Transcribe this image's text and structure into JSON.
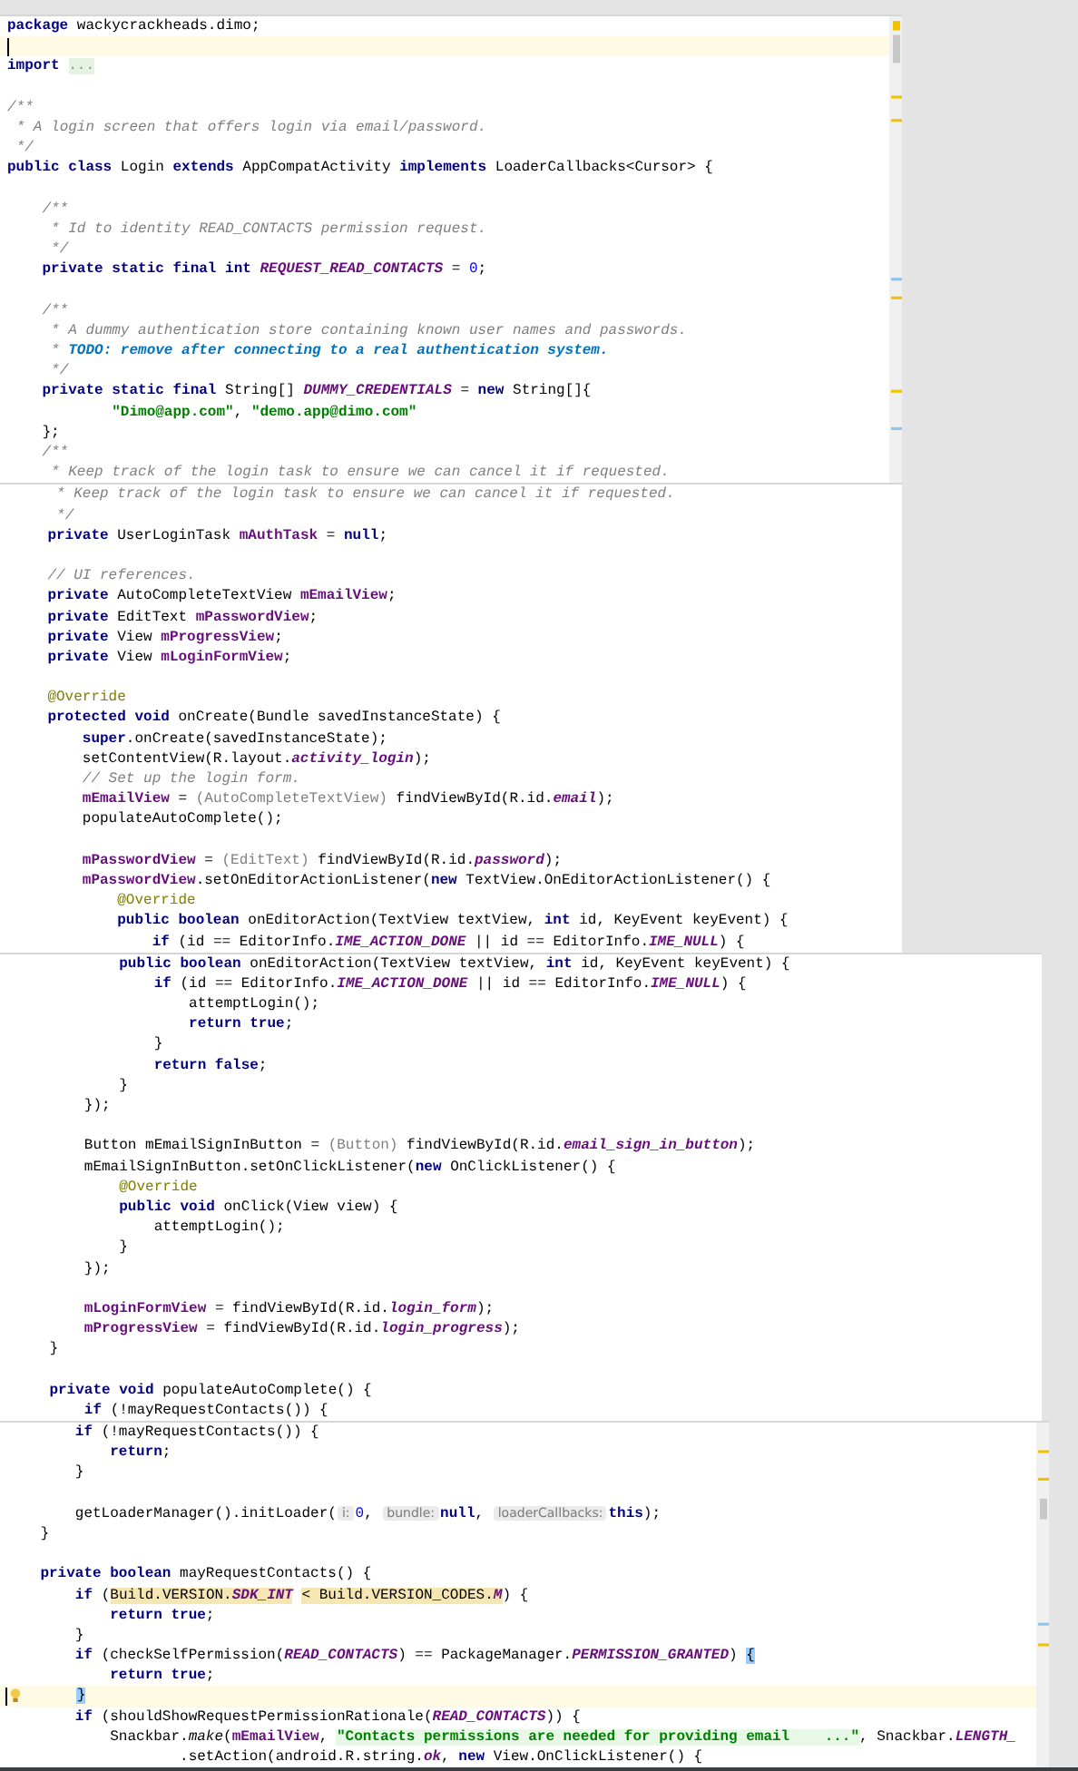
{
  "panels": [
    {
      "lines": [
        {
          "current": false,
          "bulb": false,
          "tokens": [
            {
              "kind": "kw",
              "text": "package"
            },
            {
              "kind": "plain",
              "text": " wackycrackheads.dimo;"
            }
          ]
        },
        {
          "current": true,
          "bulb": false
        },
        {
          "current": false,
          "bulb": false,
          "tokens": [
            {
              "kind": "kw",
              "text": "import "
            },
            {
              "kind": "fold",
              "text": "..."
            }
          ]
        },
        {
          "current": false,
          "bulb": false
        },
        {
          "current": false,
          "bulb": false,
          "tokens": [
            {
              "kind": "comment",
              "text": "/**"
            }
          ]
        },
        {
          "current": false,
          "bulb": false,
          "tokens": [
            {
              "kind": "comment",
              "text": " * A login screen that offers login via email/password."
            }
          ]
        },
        {
          "current": false,
          "bulb": false,
          "tokens": [
            {
              "kind": "comment",
              "text": " */"
            }
          ]
        },
        {
          "current": false,
          "bulb": false,
          "tokens": [
            {
              "kind": "kw",
              "text": "public class"
            },
            {
              "kind": "plain",
              "text": " Login "
            },
            {
              "kind": "kw",
              "text": "extends"
            },
            {
              "kind": "plain",
              "text": " AppCompatActivity "
            },
            {
              "kind": "kw",
              "text": "implements"
            },
            {
              "kind": "plain",
              "text": " LoaderCallbacks<Cursor> {"
            }
          ]
        },
        {
          "current": false,
          "bulb": false
        },
        {
          "current": false,
          "bulb": false,
          "tokens": [
            {
              "kind": "comment",
              "text": "    /**"
            }
          ]
        },
        {
          "current": false,
          "bulb": false,
          "tokens": [
            {
              "kind": "comment",
              "text": "     * Id to identity READ_CONTACTS permission request."
            }
          ]
        },
        {
          "current": false,
          "bulb": false,
          "tokens": [
            {
              "kind": "comment",
              "text": "     */"
            }
          ]
        },
        {
          "current": false,
          "bulb": false,
          "tokens": [
            {
              "kind": "kw",
              "text": "    private static final int "
            },
            {
              "kind": "const",
              "text": "REQUEST_READ_CONTACTS"
            },
            {
              "kind": "plain",
              "text": " = "
            },
            {
              "kind": "num",
              "text": "0"
            },
            {
              "kind": "plain",
              "text": ";"
            }
          ]
        },
        {
          "current": false,
          "bulb": false
        },
        {
          "current": false,
          "bulb": false,
          "tokens": [
            {
              "kind": "comment",
              "text": "    /**"
            }
          ]
        },
        {
          "current": false,
          "bulb": false,
          "tokens": [
            {
              "kind": "comment",
              "text": "     * A dummy authentication store containing known user names and passwords."
            }
          ]
        },
        {
          "current": false,
          "bulb": false,
          "tokens": [
            {
              "kind": "comment",
              "text": "     * "
            },
            {
              "kind": "todo",
              "text": "TODO: remove after connecting to a real authentication system."
            }
          ]
        },
        {
          "current": false,
          "bulb": false,
          "tokens": [
            {
              "kind": "comment",
              "text": "     */"
            }
          ]
        },
        {
          "current": false,
          "bulb": false,
          "tokens": [
            {
              "kind": "kw",
              "text": "    private static final"
            },
            {
              "kind": "plain",
              "text": " String[] "
            },
            {
              "kind": "const",
              "text": "DUMMY_CREDENTIALS"
            },
            {
              "kind": "plain",
              "text": " = "
            },
            {
              "kind": "kw",
              "text": "new"
            },
            {
              "kind": "plain",
              "text": " String[]{"
            }
          ]
        },
        {
          "current": false,
          "bulb": false,
          "tokens": [
            {
              "kind": "string",
              "text": "            \"Dimo@app.com\""
            },
            {
              "kind": "plain",
              "text": ", "
            },
            {
              "kind": "string",
              "text": "\"demo.app@dimo.com\""
            }
          ]
        },
        {
          "current": false,
          "bulb": false,
          "tokens": [
            {
              "kind": "plain",
              "text": "    };"
            }
          ]
        },
        {
          "current": false,
          "bulb": false,
          "tokens": [
            {
              "kind": "comment",
              "text": "    /**"
            }
          ]
        },
        {
          "current": false,
          "bulb": false,
          "tokens": [
            {
              "kind": "comment",
              "text": "     * Keep track of the login task to ensure we can cancel it if requested."
            }
          ]
        }
      ]
    },
    {
      "lines": [
        {
          "current": false,
          "bulb": false,
          "tokens": [
            {
              "kind": "comment",
              "text": "     * Keep track of the login task to ensure we can cancel it if requested."
            }
          ]
        },
        {
          "current": false,
          "bulb": false,
          "tokens": [
            {
              "kind": "comment",
              "text": "     */"
            }
          ]
        },
        {
          "current": false,
          "bulb": false,
          "tokens": [
            {
              "kind": "kw",
              "text": "    private"
            },
            {
              "kind": "plain",
              "text": " UserLoginTask "
            },
            {
              "kind": "field",
              "text": "mAuthTask"
            },
            {
              "kind": "plain",
              "text": " = "
            },
            {
              "kind": "kw",
              "text": "null"
            },
            {
              "kind": "plain",
              "text": ";"
            }
          ]
        },
        {
          "current": false,
          "bulb": false
        },
        {
          "current": false,
          "bulb": false,
          "tokens": [
            {
              "kind": "comment",
              "text": "    // UI references."
            }
          ]
        },
        {
          "current": false,
          "bulb": false,
          "tokens": [
            {
              "kind": "kw",
              "text": "    private"
            },
            {
              "kind": "plain",
              "text": " AutoCompleteTextView "
            },
            {
              "kind": "field",
              "text": "mEmailView"
            },
            {
              "kind": "plain",
              "text": ";"
            }
          ]
        },
        {
          "current": false,
          "bulb": false,
          "tokens": [
            {
              "kind": "kw",
              "text": "    private"
            },
            {
              "kind": "plain",
              "text": " EditText "
            },
            {
              "kind": "field",
              "text": "mPasswordView"
            },
            {
              "kind": "plain",
              "text": ";"
            }
          ]
        },
        {
          "current": false,
          "bulb": false,
          "tokens": [
            {
              "kind": "kw",
              "text": "    private"
            },
            {
              "kind": "plain",
              "text": " View "
            },
            {
              "kind": "field",
              "text": "mProgressView"
            },
            {
              "kind": "plain",
              "text": ";"
            }
          ]
        },
        {
          "current": false,
          "bulb": false,
          "tokens": [
            {
              "kind": "kw",
              "text": "    private"
            },
            {
              "kind": "plain",
              "text": " View "
            },
            {
              "kind": "field",
              "text": "mLoginFormView"
            },
            {
              "kind": "plain",
              "text": ";"
            }
          ]
        },
        {
          "current": false,
          "bulb": false
        },
        {
          "current": false,
          "bulb": false,
          "tokens": [
            {
              "kind": "anno",
              "text": "    @Override"
            }
          ]
        },
        {
          "current": false,
          "bulb": false,
          "tokens": [
            {
              "kind": "kw",
              "text": "    protected void"
            },
            {
              "kind": "plain",
              "text": " onCreate(Bundle savedInstanceState) {"
            }
          ]
        },
        {
          "current": false,
          "bulb": false,
          "tokens": [
            {
              "kind": "kw",
              "text": "        super"
            },
            {
              "kind": "plain",
              "text": ".onCreate(savedInstanceState);"
            }
          ]
        },
        {
          "current": false,
          "bulb": false,
          "tokens": [
            {
              "kind": "plain",
              "text": "        setContentView(R.layout."
            },
            {
              "kind": "const",
              "text": "activity_login"
            },
            {
              "kind": "plain",
              "text": ");"
            }
          ]
        },
        {
          "current": false,
          "bulb": false,
          "tokens": [
            {
              "kind": "comment",
              "text": "        // Set up the login form."
            }
          ]
        },
        {
          "current": false,
          "bulb": false,
          "tokens": [
            {
              "kind": "field",
              "text": "        mEmailView"
            },
            {
              "kind": "plain",
              "text": " = "
            },
            {
              "kind": "cast",
              "text": "(AutoCompleteTextView)"
            },
            {
              "kind": "plain",
              "text": " findViewById(R.id."
            },
            {
              "kind": "const",
              "text": "email"
            },
            {
              "kind": "plain",
              "text": ");"
            }
          ]
        },
        {
          "current": false,
          "bulb": false,
          "tokens": [
            {
              "kind": "plain",
              "text": "        populateAutoComplete();"
            }
          ]
        },
        {
          "current": false,
          "bulb": false
        },
        {
          "current": false,
          "bulb": false,
          "tokens": [
            {
              "kind": "field",
              "text": "        mPasswordView"
            },
            {
              "kind": "plain",
              "text": " = "
            },
            {
              "kind": "cast",
              "text": "(EditText)"
            },
            {
              "kind": "plain",
              "text": " findViewById(R.id."
            },
            {
              "kind": "const",
              "text": "password"
            },
            {
              "kind": "plain",
              "text": ");"
            }
          ]
        },
        {
          "current": false,
          "bulb": false,
          "tokens": [
            {
              "kind": "field",
              "text": "        mPasswordView"
            },
            {
              "kind": "plain",
              "text": ".setOnEditorActionListener("
            },
            {
              "kind": "kw",
              "text": "new"
            },
            {
              "kind": "plain",
              "text": " TextView.OnEditorActionListener() {"
            }
          ]
        },
        {
          "current": false,
          "bulb": false,
          "tokens": [
            {
              "kind": "anno",
              "text": "            @Override"
            }
          ]
        },
        {
          "current": false,
          "bulb": false,
          "tokens": [
            {
              "kind": "kw",
              "text": "            public boolean"
            },
            {
              "kind": "plain",
              "text": " onEditorAction(TextView textView, "
            },
            {
              "kind": "kw",
              "text": "int"
            },
            {
              "kind": "plain",
              "text": " id, KeyEvent keyEvent) {"
            }
          ]
        },
        {
          "current": false,
          "bulb": false,
          "tokens": [
            {
              "kind": "kw",
              "text": "                if"
            },
            {
              "kind": "plain",
              "text": " (id == EditorInfo."
            },
            {
              "kind": "const",
              "text": "IME_ACTION_DONE"
            },
            {
              "kind": "plain",
              "text": " || id == EditorInfo."
            },
            {
              "kind": "const",
              "text": "IME_NULL"
            },
            {
              "kind": "plain",
              "text": ") {"
            }
          ]
        }
      ]
    },
    {
      "lines": [
        {
          "current": false,
          "bulb": false,
          "tokens": [
            {
              "kind": "kw",
              "text": "            public boolean"
            },
            {
              "kind": "plain",
              "text": " onEditorAction(TextView textView, "
            },
            {
              "kind": "kw",
              "text": "int"
            },
            {
              "kind": "plain",
              "text": " id, KeyEvent keyEvent) {"
            }
          ]
        },
        {
          "current": false,
          "bulb": false,
          "tokens": [
            {
              "kind": "kw",
              "text": "                if"
            },
            {
              "kind": "plain",
              "text": " (id == EditorInfo."
            },
            {
              "kind": "const",
              "text": "IME_ACTION_DONE"
            },
            {
              "kind": "plain",
              "text": " || id == EditorInfo."
            },
            {
              "kind": "const",
              "text": "IME_NULL"
            },
            {
              "kind": "plain",
              "text": ") {"
            }
          ]
        },
        {
          "current": false,
          "bulb": false,
          "tokens": [
            {
              "kind": "plain",
              "text": "                    attemptLogin();"
            }
          ]
        },
        {
          "current": false,
          "bulb": false,
          "tokens": [
            {
              "kind": "kw",
              "text": "                    return true"
            },
            {
              "kind": "plain",
              "text": ";"
            }
          ]
        },
        {
          "current": false,
          "bulb": false,
          "tokens": [
            {
              "kind": "plain",
              "text": "                }"
            }
          ]
        },
        {
          "current": false,
          "bulb": false,
          "tokens": [
            {
              "kind": "kw",
              "text": "                return false"
            },
            {
              "kind": "plain",
              "text": ";"
            }
          ]
        },
        {
          "current": false,
          "bulb": false,
          "tokens": [
            {
              "kind": "plain",
              "text": "            }"
            }
          ]
        },
        {
          "current": false,
          "bulb": false,
          "tokens": [
            {
              "kind": "plain",
              "text": "        });"
            }
          ]
        },
        {
          "current": false,
          "bulb": false
        },
        {
          "current": false,
          "bulb": false,
          "tokens": [
            {
              "kind": "plain",
              "text": "        Button mEmailSignInButton = "
            },
            {
              "kind": "cast",
              "text": "(Button)"
            },
            {
              "kind": "plain",
              "text": " findViewById(R.id."
            },
            {
              "kind": "const",
              "text": "email_sign_in_button"
            },
            {
              "kind": "plain",
              "text": ");"
            }
          ]
        },
        {
          "current": false,
          "bulb": false,
          "tokens": [
            {
              "kind": "plain",
              "text": "        mEmailSignInButton.setOnClickListener("
            },
            {
              "kind": "kw",
              "text": "new"
            },
            {
              "kind": "plain",
              "text": " OnClickListener() {"
            }
          ]
        },
        {
          "current": false,
          "bulb": false,
          "tokens": [
            {
              "kind": "anno",
              "text": "            @Override"
            }
          ]
        },
        {
          "current": false,
          "bulb": false,
          "tokens": [
            {
              "kind": "kw",
              "text": "            public void"
            },
            {
              "kind": "plain",
              "text": " onClick(View view) {"
            }
          ]
        },
        {
          "current": false,
          "bulb": false,
          "tokens": [
            {
              "kind": "plain",
              "text": "                attemptLogin();"
            }
          ]
        },
        {
          "current": false,
          "bulb": false,
          "tokens": [
            {
              "kind": "plain",
              "text": "            }"
            }
          ]
        },
        {
          "current": false,
          "bulb": false,
          "tokens": [
            {
              "kind": "plain",
              "text": "        });"
            }
          ]
        },
        {
          "current": false,
          "bulb": false
        },
        {
          "current": false,
          "bulb": false,
          "tokens": [
            {
              "kind": "field",
              "text": "        mLoginFormView"
            },
            {
              "kind": "plain",
              "text": " = findViewById(R.id."
            },
            {
              "kind": "const",
              "text": "login_form"
            },
            {
              "kind": "plain",
              "text": ");"
            }
          ]
        },
        {
          "current": false,
          "bulb": false,
          "tokens": [
            {
              "kind": "field",
              "text": "        mProgressView"
            },
            {
              "kind": "plain",
              "text": " = findViewById(R.id."
            },
            {
              "kind": "const",
              "text": "login_progress"
            },
            {
              "kind": "plain",
              "text": ");"
            }
          ]
        },
        {
          "current": false,
          "bulb": false,
          "tokens": [
            {
              "kind": "plain",
              "text": "    }"
            }
          ]
        },
        {
          "current": false,
          "bulb": false
        },
        {
          "current": false,
          "bulb": false,
          "tokens": [
            {
              "kind": "kw",
              "text": "    private void"
            },
            {
              "kind": "plain",
              "text": " populateAutoComplete() {"
            }
          ]
        },
        {
          "current": false,
          "bulb": false,
          "tokens": [
            {
              "kind": "kw",
              "text": "        if"
            },
            {
              "kind": "plain",
              "text": " (!mayRequestContacts()) {"
            }
          ]
        }
      ]
    },
    {
      "lines": [
        {
          "current": false,
          "bulb": false,
          "tokens": [
            {
              "kind": "kw",
              "text": "        if"
            },
            {
              "kind": "plain",
              "text": " (!mayRequestContacts()) {"
            }
          ]
        },
        {
          "current": false,
          "bulb": false,
          "tokens": [
            {
              "kind": "kw",
              "text": "            return"
            },
            {
              "kind": "plain",
              "text": ";"
            }
          ]
        },
        {
          "current": false,
          "bulb": false,
          "tokens": [
            {
              "kind": "plain",
              "text": "        }"
            }
          ]
        },
        {
          "current": false,
          "bulb": false
        },
        {
          "current": false,
          "bulb": false,
          "tokens": [
            {
              "kind": "plain",
              "text": "        getLoaderManager().initLoader("
            },
            {
              "kind": "hint",
              "text": "i:"
            },
            {
              "kind": "num",
              "text": "0"
            },
            {
              "kind": "plain",
              "text": ", "
            },
            {
              "kind": "hint",
              "text": "bundle:"
            },
            {
              "kind": "kw",
              "text": "null"
            },
            {
              "kind": "plain",
              "text": ", "
            },
            {
              "kind": "hint",
              "text": "loaderCallbacks:"
            },
            {
              "kind": "kw",
              "text": "this"
            },
            {
              "kind": "plain",
              "text": ");"
            }
          ]
        },
        {
          "current": false,
          "bulb": false,
          "tokens": [
            {
              "kind": "plain",
              "text": "    }"
            }
          ]
        },
        {
          "current": false,
          "bulb": false
        },
        {
          "current": false,
          "bulb": false,
          "tokens": [
            {
              "kind": "kw",
              "text": "    private boolean"
            },
            {
              "kind": "plain",
              "text": " mayRequestContacts() {"
            }
          ]
        },
        {
          "current": false,
          "bulb": false,
          "tokens": [
            {
              "kind": "kw",
              "text": "        if"
            },
            {
              "kind": "plain",
              "text": " ("
            },
            {
              "kind": "hl",
              "text": "Build.VERSION."
            },
            {
              "kind": "hl-const",
              "text": "SDK_INT"
            },
            {
              "kind": "hl",
              "text": " < Build.VERSION_CODES."
            },
            {
              "kind": "hl-const",
              "text": "M"
            },
            {
              "kind": "plain",
              "text": ") {"
            }
          ]
        },
        {
          "current": false,
          "bulb": false,
          "tokens": [
            {
              "kind": "kw",
              "text": "            return true"
            },
            {
              "kind": "plain",
              "text": ";"
            }
          ]
        },
        {
          "current": false,
          "bulb": false,
          "tokens": [
            {
              "kind": "plain",
              "text": "        }"
            }
          ]
        },
        {
          "current": false,
          "bulb": false,
          "tokens": [
            {
              "kind": "kw",
              "text": "        if"
            },
            {
              "kind": "plain",
              "text": " (checkSelfPermission("
            },
            {
              "kind": "const",
              "text": "READ_CONTACTS"
            },
            {
              "kind": "plain",
              "text": ") == PackageManager."
            },
            {
              "kind": "const",
              "text": "PERMISSION_GRANTED"
            },
            {
              "kind": "plain",
              "text": ") "
            },
            {
              "kind": "brace",
              "text": "{"
            }
          ]
        },
        {
          "current": false,
          "bulb": false,
          "tokens": [
            {
              "kind": "kw",
              "text": "            return true"
            },
            {
              "kind": "plain",
              "text": ";"
            }
          ]
        },
        {
          "current": true,
          "bulb": true,
          "tokens": [
            {
              "kind": "brace",
              "text": "        }"
            }
          ]
        },
        {
          "current": false,
          "bulb": false,
          "tokens": [
            {
              "kind": "kw",
              "text": "        if"
            },
            {
              "kind": "plain",
              "text": " (shouldShowRequestPermissionRationale("
            },
            {
              "kind": "const",
              "text": "READ_CONTACTS"
            },
            {
              "kind": "plain",
              "text": ")) {"
            }
          ]
        },
        {
          "current": false,
          "bulb": false,
          "tokens": [
            {
              "kind": "plain",
              "text": "            Snackbar."
            },
            {
              "kind": "static",
              "text": "make"
            },
            {
              "kind": "plain",
              "text": "("
            },
            {
              "kind": "field",
              "text": "mEmailView"
            },
            {
              "kind": "plain",
              "text": ", "
            },
            {
              "kind": "string-hl",
              "text": "\"Contacts permissions are needed for providing email    ...\""
            },
            {
              "kind": "plain",
              "text": ", Snackbar."
            },
            {
              "kind": "const",
              "text": "LENGTH_"
            }
          ]
        },
        {
          "current": false,
          "bulb": false,
          "tokens": [
            {
              "kind": "plain",
              "text": "                    .setAction(android.R.string."
            },
            {
              "kind": "const",
              "text": "ok"
            },
            {
              "kind": "plain",
              "text": ", "
            },
            {
              "kind": "kw",
              "text": "new"
            },
            {
              "kind": "plain",
              "text": " View.OnClickListener() {"
            }
          ]
        }
      ]
    }
  ]
}
